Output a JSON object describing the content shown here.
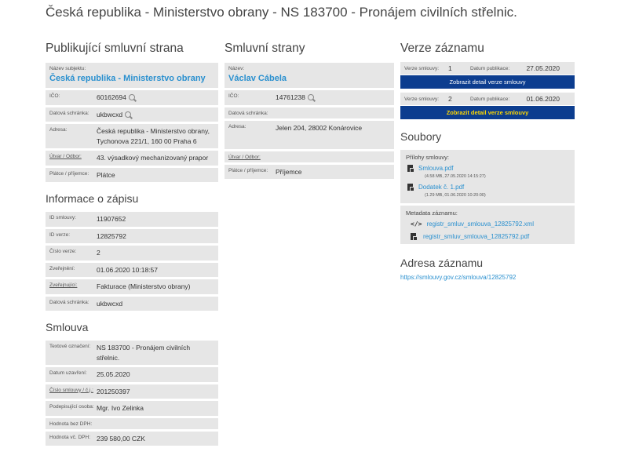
{
  "page": {
    "title": "Česká republika - Ministerstvo obrany - NS 183700 - Pronájem civilních střelnic."
  },
  "publisher": {
    "heading": "Publikující smluvní strana",
    "name_label": "Název subjektu:",
    "name": "Česká republika - Ministerstvo obrany",
    "ico_label": "IČO:",
    "ico": "60162694",
    "ds_label": "Datová schránka:",
    "ds": "ukbwcxd",
    "address_label": "Adresa:",
    "address": "Česká republika - Ministerstvo obrany, Tychonova 221/1, 160 00 Praha 6",
    "dept_label": "Útvar / Odbor:",
    "dept": "43. výsadkový mechanizovaný prapor",
    "role_label": "Plátce / příjemce:",
    "role": "Plátce"
  },
  "record": {
    "heading": "Informace o zápisu",
    "id_label": "ID smlouvy:",
    "id": "11907652",
    "ver_id_label": "ID verze:",
    "ver_id": "12825792",
    "ver_no_label": "Číslo verze:",
    "ver_no": "2",
    "published_label": "Zveřejnění:",
    "published": "01.06.2020 10:18:57",
    "publisher_label": "Zveřejnující:",
    "publisher": "Fakturace (Ministerstvo obrany)",
    "ds_label": "Datová schránka:",
    "ds": "ukbwcxd"
  },
  "contract": {
    "heading": "Smlouva",
    "subject_label": "Textové označení:",
    "subject": "NS 183700 - Pronájem civilních střelnic.",
    "date_label": "Datum uzavření:",
    "date": "25.05.2020",
    "number_label": "Číslo smlouvy / č.j.:",
    "number": "201250397",
    "signer_label": "Podepisující osoba:",
    "signer": "Mgr. Ivo Zelinka",
    "value_nodph_label": "Hodnota bez DPH:",
    "value_nodph": "",
    "value_dph_label": "Hodnota vč. DPH:",
    "value_dph": "239 580,00 CZK"
  },
  "party": {
    "heading": "Smluvní strany",
    "name_label": "Název:",
    "name": "Václav Cábela",
    "ico_label": "IČO:",
    "ico": "14761238",
    "ds_label": "Datová schránka:",
    "ds": "",
    "address_label": "Adresa:",
    "address": "Jelen 204, 28002 Konárovice",
    "dept_label": "Útvar / Odbor:",
    "dept": "",
    "role_label": "Plátce / příjemce:",
    "role": "Příjemce"
  },
  "versions": {
    "heading": "Verze záznamu",
    "ver_label": "Verze smlouvy:",
    "date_label": "Datum publikace:",
    "items": [
      {
        "n": "1",
        "date": "27.05.2020",
        "button": "Zobrazit detail verze smlouvy"
      },
      {
        "n": "2",
        "date": "01.06.2020",
        "button": "Zobrazit detail verze smlouvy"
      }
    ]
  },
  "files": {
    "heading": "Soubory",
    "attach_label": "Přílohy smlouvy:",
    "attachments": [
      {
        "name": "Smlouva.pdf",
        "meta": "(4.58 MB, 27.05.2020 14:15:27)"
      },
      {
        "name": "Dodatek č. 1.pdf",
        "meta": "(1.29 MB, 01.06.2020 10:20:00)"
      }
    ],
    "meta_label": "Metadata záznamu:",
    "metadata": [
      {
        "name": "registr_smluv_smlouva_12825792.xml"
      },
      {
        "name": "registr_smluv_smlouva_12825792.pdf"
      }
    ]
  },
  "address_section": {
    "heading": "Adresa záznamu",
    "url": "https://smlouvy.gov.cz/smlouva/12825792"
  },
  "colors": {
    "link": "#2a90cf",
    "button_bg": "#0c3d8f",
    "button_highlight_text": "#ffd900",
    "row_bg": "#e6e6e6"
  }
}
